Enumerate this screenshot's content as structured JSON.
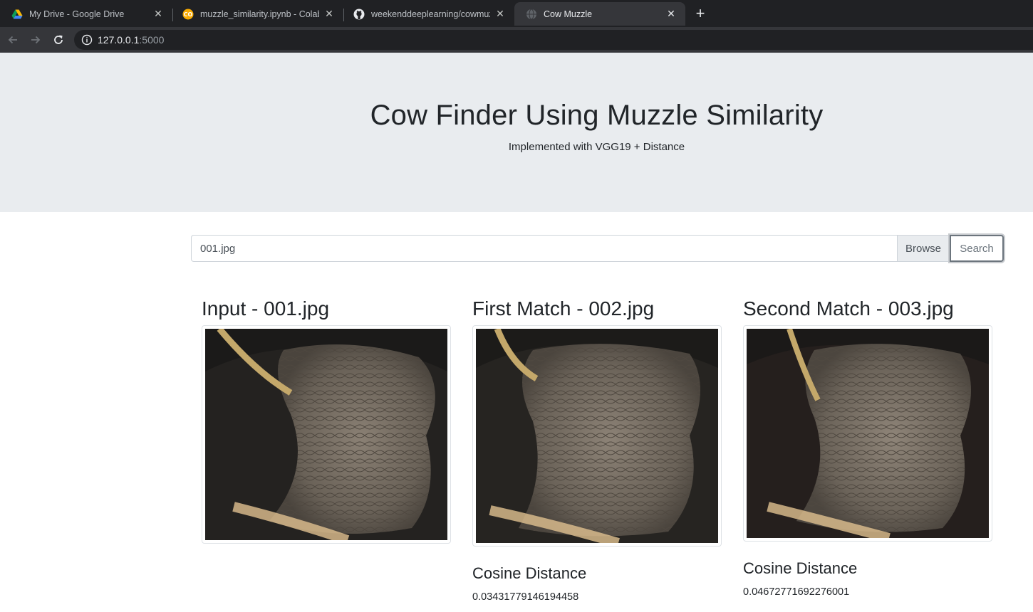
{
  "browser": {
    "tabs": [
      {
        "title": "My Drive - Google Drive",
        "icon": "google-drive-icon",
        "close": "✕"
      },
      {
        "title": "muzzle_similarity.ipynb - Colabor",
        "icon": "colab-icon",
        "close": "✕"
      },
      {
        "title": "weekenddeeplearning/cowmuzzl",
        "icon": "github-icon",
        "close": "✕"
      },
      {
        "title": "Cow Muzzle",
        "icon": "globe-icon",
        "close": "✕"
      }
    ],
    "new_tab": "+",
    "address": {
      "host": "127.0.0.1",
      "port": ":5000"
    }
  },
  "header": {
    "title": "Cow Finder Using Muzzle Similarity",
    "subtitle": "Implemented with VGG19 + Distance"
  },
  "search": {
    "file_value": "001.jpg",
    "browse_label": "Browse",
    "search_label": "Search"
  },
  "results": {
    "input_title": "Input - 001.jpg",
    "first_title": "First Match - 002.jpg",
    "second_title": "Second Match - 003.jpg",
    "distance_label": "Cosine Distance",
    "first_distance": "0.03431779146194458",
    "second_distance": "0.04672771692276001"
  }
}
